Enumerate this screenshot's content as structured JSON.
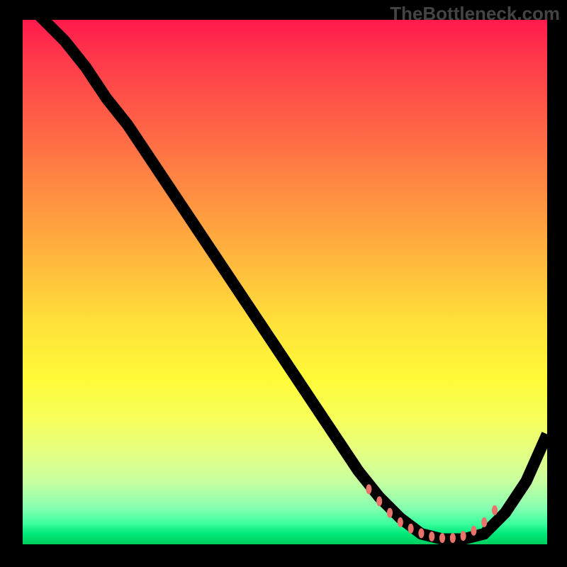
{
  "watermark": "TheBottleneck.com",
  "chart_data": {
    "type": "line",
    "title": "",
    "xlabel": "",
    "ylabel": "",
    "xlim": [
      0,
      100
    ],
    "ylim": [
      0,
      100
    ],
    "grid": false,
    "legend": false,
    "series": [
      {
        "name": "curve",
        "x": [
          0,
          4,
          8,
          12,
          16,
          20,
          24,
          28,
          32,
          36,
          40,
          44,
          48,
          52,
          56,
          60,
          64,
          68,
          72,
          76,
          80,
          84,
          88,
          92,
          96,
          100
        ],
        "y": [
          104,
          100,
          96,
          91,
          85,
          80,
          74,
          68,
          62,
          56,
          50,
          44,
          38,
          32,
          26,
          20,
          14,
          9,
          5,
          2,
          1,
          1,
          2,
          6,
          12,
          21
        ]
      }
    ],
    "markers": {
      "name": "highlight-dots",
      "x": [
        66,
        68,
        70,
        72,
        74,
        76,
        78,
        80,
        82,
        84,
        86,
        88,
        90
      ],
      "y": [
        10.5,
        8.2,
        6.0,
        4.2,
        3.0,
        2.1,
        1.5,
        1.2,
        1.2,
        1.6,
        2.6,
        4.2,
        6.5
      ]
    },
    "background_gradient": {
      "direction": "vertical",
      "stops": [
        {
          "pos": 0.0,
          "color": "#ff1a4d"
        },
        {
          "pos": 0.5,
          "color": "#ffbf3d"
        },
        {
          "pos": 0.75,
          "color": "#f7ff5a"
        },
        {
          "pos": 1.0,
          "color": "#00d060"
        }
      ]
    }
  }
}
